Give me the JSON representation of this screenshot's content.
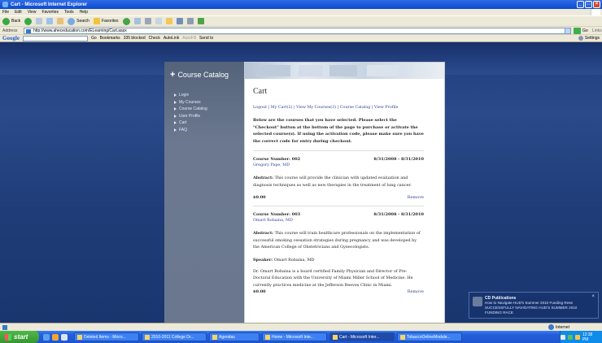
{
  "window": {
    "title": "Cart - Microsoft Internet Explorer",
    "controls": [
      "_",
      "□",
      "×"
    ]
  },
  "menu": [
    "File",
    "Edit",
    "View",
    "Favorites",
    "Tools",
    "Help"
  ],
  "toolbar": {
    "back": "Back",
    "search": "Search",
    "favorites": "Favorites"
  },
  "address": {
    "label": "Address",
    "url": "http://www.aheceducation.com/ELearning/Cart.aspx",
    "go": "Go",
    "links": "Links"
  },
  "googlebar": {
    "logo": "Google",
    "go": "Go",
    "bookmarks": "Bookmarks",
    "blocked": "335 blocked",
    "check": "Check",
    "autolink": "AutoLink",
    "autofill": "AutoFill",
    "sendto": "Send to",
    "settings": "Settings"
  },
  "sidebar": {
    "title": "Course Catalog",
    "items": [
      "Login",
      "My Courses",
      "Course Catalog",
      "User Profile",
      "Cart",
      "FAQ"
    ]
  },
  "page": {
    "title": "Cart",
    "links": "Logout | My Cart(2) | View My Courses(3) | Course Catalog | View Profile",
    "intro": "Below are the courses that you have selected. Please select the \"Checkout\" button at the bottom of the page to purchase or activate the selected course(s). If using the activation code, please make sure you have the correct code for entry during checkout."
  },
  "courses": [
    {
      "number": "Course Number: 002",
      "dates": "8/31/2008 - 8/31/2010",
      "instructor": "Gregory Pape, MD",
      "abstract_label": "Abstract:",
      "abstract": "This course will provide the clinician with updated evaluation and diagnosis techniques as well as new therapies in the treatment of lung cancer.",
      "price": "$0.00",
      "remove": "Remove"
    },
    {
      "number": "Course Number: 003",
      "dates": "8/31/2008 - 8/31/2010",
      "instructor": "Omart Robaina, MD",
      "abstract_label": "Abstract:",
      "abstract": "This course will train healthcare professionals on the implementation of successful smoking cessation strategies during pregnancy and was developed by the American College of Obstetricians and Gynecologists.",
      "speaker_label": "Speaker:",
      "speaker": "Omart Robaina, MD",
      "bio": "Dr. Omart Robaina is a board certified Family Physician and Director of Pre-Doctoral Education with the University of Miami Miller School of Medicine. He currently practices medicine at the Jefferson Reeves Clinic in Miami.",
      "price": "$0.00",
      "remove": "Remove"
    }
  ],
  "notification": {
    "title": "CD Publications",
    "line1": "How to Navigate HUD's Summer 2010 Funding Rese",
    "line2": "SUCCESSFULLY NAVIGATING HUD'S SUMMER 2010",
    "line3": "FUNDING RACE"
  },
  "status": {
    "zone": "Internet"
  },
  "taskbar": {
    "start": "start",
    "tasks": [
      "Deleted Items - Micro...",
      "2010-2011 College Dr...",
      "Agendas",
      "Home - Microsoft Inte...",
      "Cart - Microsoft Inter...",
      "TobaccoOnlineModule..."
    ],
    "clock": "12:38 PM"
  }
}
